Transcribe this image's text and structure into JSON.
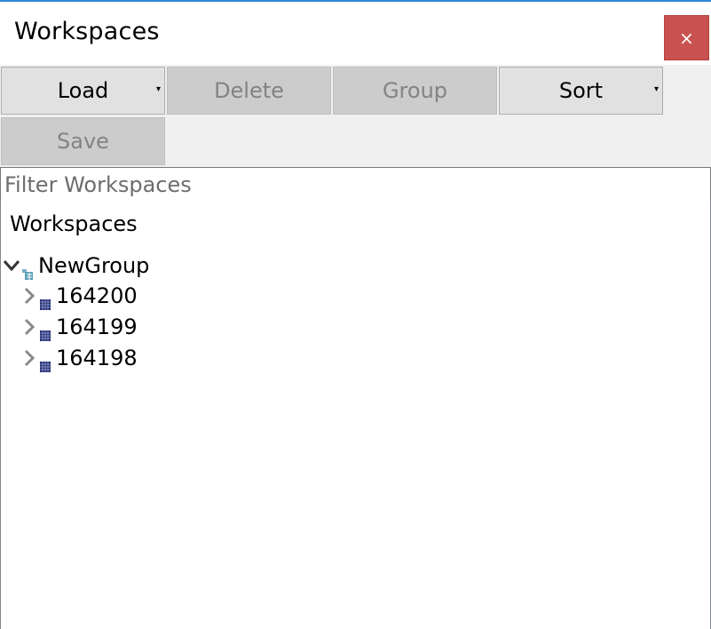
{
  "window": {
    "title": "Workspaces",
    "close_label": "×"
  },
  "toolbar": {
    "load_label": "Load",
    "delete_label": "Delete",
    "group_label": "Group",
    "sort_label": "Sort",
    "save_label": "Save",
    "dropdown_glyph": "▾"
  },
  "filter": {
    "placeholder": "Filter Workspaces",
    "value": ""
  },
  "tree": {
    "header": "Workspaces",
    "group": {
      "label": "NewGroup",
      "expanded": true,
      "icon": "group-folder-icon"
    },
    "items": [
      {
        "label": "164200",
        "icon": "matrix-workspace-icon",
        "expanded": false
      },
      {
        "label": "164199",
        "icon": "matrix-workspace-icon",
        "expanded": false
      },
      {
        "label": "164198",
        "icon": "matrix-workspace-icon",
        "expanded": false
      }
    ]
  },
  "colors": {
    "close_button": "#c9514f",
    "window_border_accent": "#2b88d8",
    "disabled_button": "#cccccc",
    "enabled_button": "#e1e1e1",
    "workspace_icon": "#1f2a6b"
  }
}
